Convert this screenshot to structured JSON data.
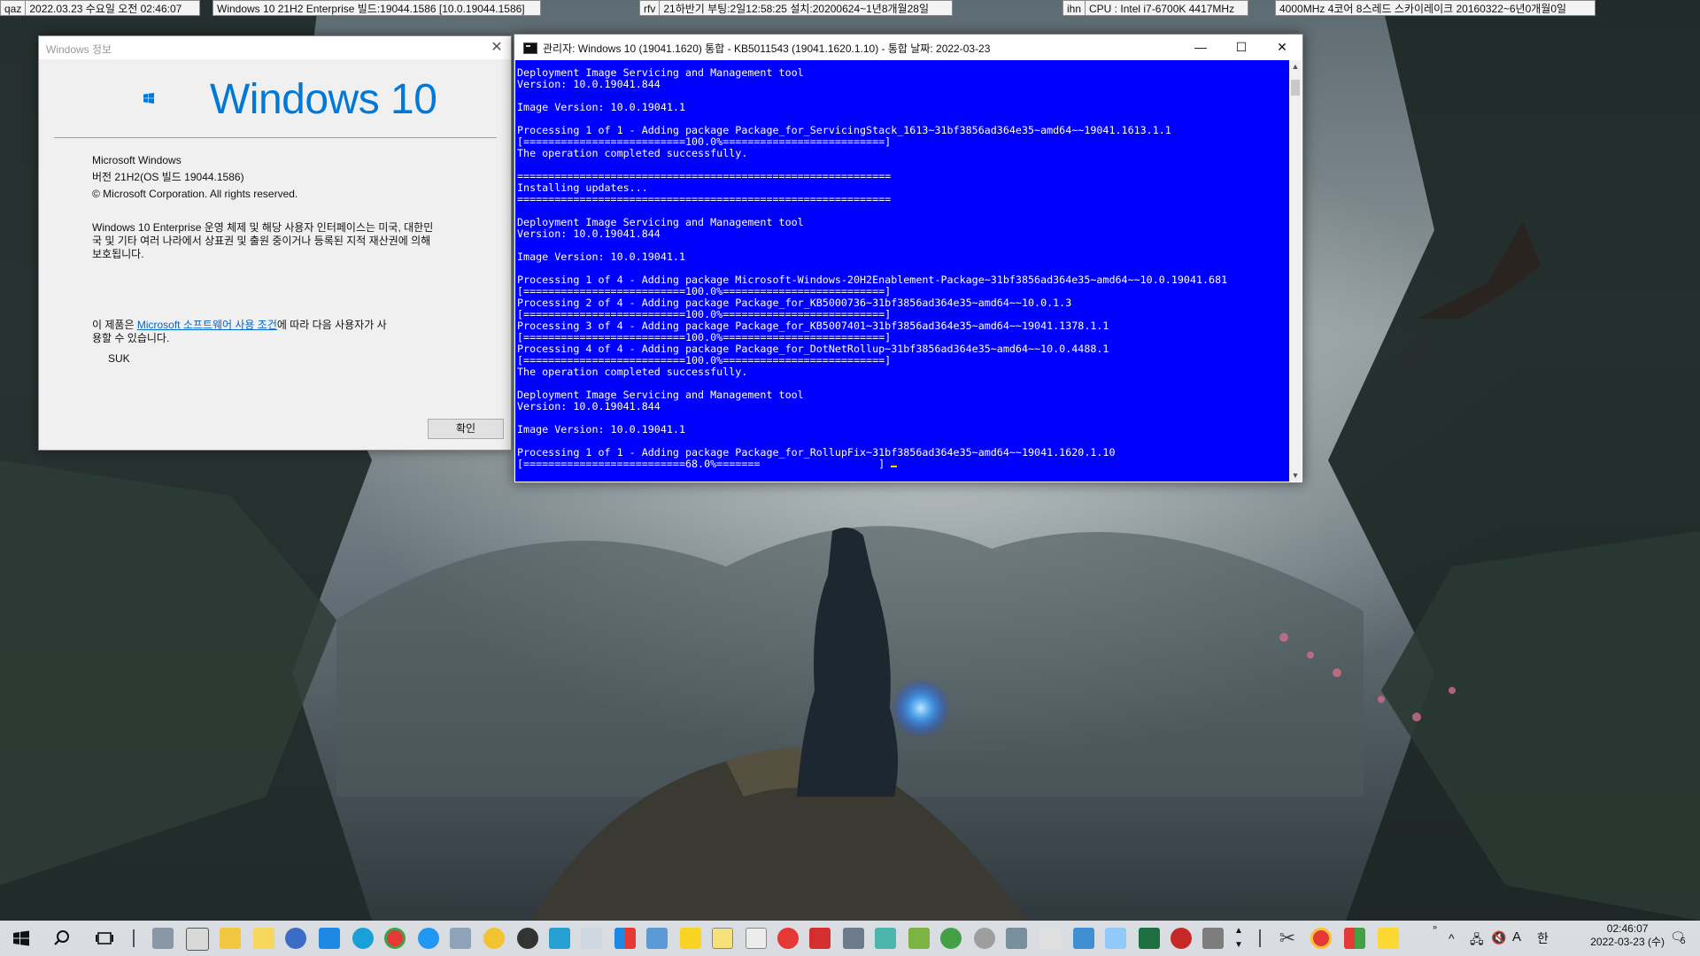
{
  "topbar": {
    "seg1_label": "qaz",
    "seg1_value": "2022.03.23 수요일 오전 02:46:07",
    "seg2_value": "Windows 10 21H2 Enterprise 빌드:19044.1586 [10.0.19044.1586]",
    "seg3_label": "rfv",
    "seg3_value": "21하반기 부팅:2일12:58:25 설치:20200624~1년8개월28일",
    "seg4_label": "ihn",
    "seg4_value": "CPU : Intel i7-6700K 4417MHz",
    "seg5_value": "4000MHz 4코어 8스레드 스카이레이크 20160322~6년0개월0일"
  },
  "about": {
    "title": "Windows 정보",
    "logo_text": "Windows 10",
    "product": "Microsoft Windows",
    "version": "버전 21H2(OS 빌드 19044.1586)",
    "copyright": "© Microsoft Corporation. All rights reserved.",
    "notice_line1": "Windows 10 Enterprise 운영 체제 및 해당 사용자 인터페이스는 미국, 대한민",
    "notice_line2": "국 및 기타 여러 나라에서 상표권 및 출원 중이거나 등록된 지적 재산권에 의해",
    "notice_line3": "보호됩니다.",
    "license_prefix": "이 제품은 ",
    "license_link": "Microsoft 소프트웨어 사용 조건",
    "license_suffix": "에 따라 다음 사용자가 사",
    "license_line2": "용할 수 있습니다.",
    "user": "SUK",
    "ok_label": "확인"
  },
  "console": {
    "title": "관리자:  Windows 10 (19041.1620) 통합 - KB5011543 (19041.1620.1.10) - 통합 날짜: 2022-03-23",
    "lines": [
      "Deployment Image Servicing and Management tool",
      "Version: 10.0.19041.844",
      "",
      "Image Version: 10.0.19041.1",
      "",
      "Processing 1 of 1 - Adding package Package_for_ServicingStack_1613~31bf3856ad364e35~amd64~~19041.1613.1.1",
      "[==========================100.0%==========================]",
      "The operation completed successfully.",
      "",
      "============================================================",
      "Installing updates...",
      "============================================================",
      "",
      "Deployment Image Servicing and Management tool",
      "Version: 10.0.19041.844",
      "",
      "Image Version: 10.0.19041.1",
      "",
      "Processing 1 of 4 - Adding package Microsoft-Windows-20H2Enablement-Package~31bf3856ad364e35~amd64~~10.0.19041.681",
      "[==========================100.0%==========================]",
      "Processing 2 of 4 - Adding package Package_for_KB5000736~31bf3856ad364e35~amd64~~10.0.1.3",
      "[==========================100.0%==========================]",
      "Processing 3 of 4 - Adding package Package_for_KB5007401~31bf3856ad364e35~amd64~~19041.1378.1.1",
      "[==========================100.0%==========================]",
      "Processing 4 of 4 - Adding package Package_for_DotNetRollup~31bf3856ad364e35~amd64~~10.0.4488.1",
      "[==========================100.0%==========================]",
      "The operation completed successfully.",
      "",
      "Deployment Image Servicing and Management tool",
      "Version: 10.0.19041.844",
      "",
      "Image Version: 10.0.19041.1",
      "",
      "Processing 1 of 1 - Adding package Package_for_RollupFix~31bf3856ad364e35~amd64~~19041.1620.1.10"
    ],
    "progress_line": "[==========================68.0%=======                   ] ",
    "progress_percent": 68.0
  },
  "taskbar": {
    "tray_ime_letter": "A",
    "tray_ime_lang": "한",
    "clock_time": "02:46:07",
    "clock_date": "2022-03-23 (수)",
    "notification_count": "5"
  },
  "colors": {
    "console_bg": "#0000ff",
    "windows_blue": "#0078d7",
    "link": "#0066cc"
  }
}
